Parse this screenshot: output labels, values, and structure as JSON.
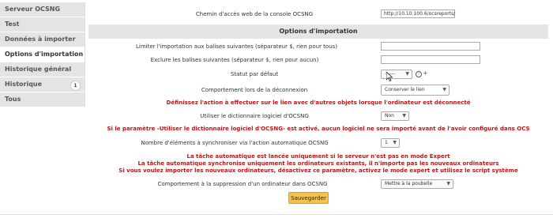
{
  "sidebar": {
    "items": [
      {
        "label": "Serveur OCSNG"
      },
      {
        "label": "Test"
      },
      {
        "label": "Données à importer"
      },
      {
        "label": "Options d'importation"
      },
      {
        "label": "Historique général"
      },
      {
        "label": "Historique",
        "badge": "1"
      },
      {
        "label": "Tous"
      }
    ]
  },
  "form": {
    "web_console_label": "Chemin d'accès web de la console OCSNG",
    "web_console_value": "http://10.10.100.6/ocsreports/",
    "section_title": "Options d'importation",
    "limit_tags_label": "Limiter l'importation aux balises suivantes (séparateur $, rien pour tous)",
    "limit_tags_value": "",
    "exclude_tags_label": "Exclure les balises suivantes (séparateur $, rien pour aucun)",
    "exclude_tags_value": "",
    "default_status_label": "Statut par défaut",
    "default_status_value": "------",
    "disconnect_label": "Comportement lors de la déconnexion",
    "disconnect_value": "Conserver le lien",
    "disconnect_warning": "Définissez l'action à effectuer sur le lien avec d'autres objets lorsque l'ordinateur est déconnecté",
    "soft_dict_label": "Utiliser le dictionnaire logiciel d'OCSNG",
    "soft_dict_value": "Non",
    "soft_dict_warning": "Si le paramètre -Utiliser le dictionnaire logiciel d'OCSNG- est activé, aucun logiciel ne sera importé avant de l'avoir configuré dans OCS",
    "sync_count_label": "Nombre d'éléments à synchroniser via l'action automatique OCSNG",
    "sync_count_value": "1",
    "auto_warning_1": "La tâche automatique est lancée uniquement si le serveur n'est pas en mode Expert",
    "auto_warning_2": "La tâche automatique synchronise uniquement les ordinateurs existants, il n'importe pas les nouveaux ordinateurs",
    "auto_warning_3": "Si vous voulez importer les nouveaux ordinateurs, désactivez ce paramètre, activez le mode expert et utilisez le script système",
    "deletion_label": "Comportement à la suppression d'un ordinateur dans OCSNG",
    "deletion_value": "Mettre à la poubelle",
    "save_label": "Sauvegarder"
  },
  "icons": {
    "info": "info-icon",
    "add": "plus-icon",
    "dropdown": "chevron-down-icon",
    "cursor": "mouse-pointer-icon"
  },
  "colors": {
    "warning_text": "#cc1111",
    "save_button": "#f5c14a",
    "section_header_bg": "#e5e5e5",
    "sidebar_bg": "#e4e4e4"
  }
}
